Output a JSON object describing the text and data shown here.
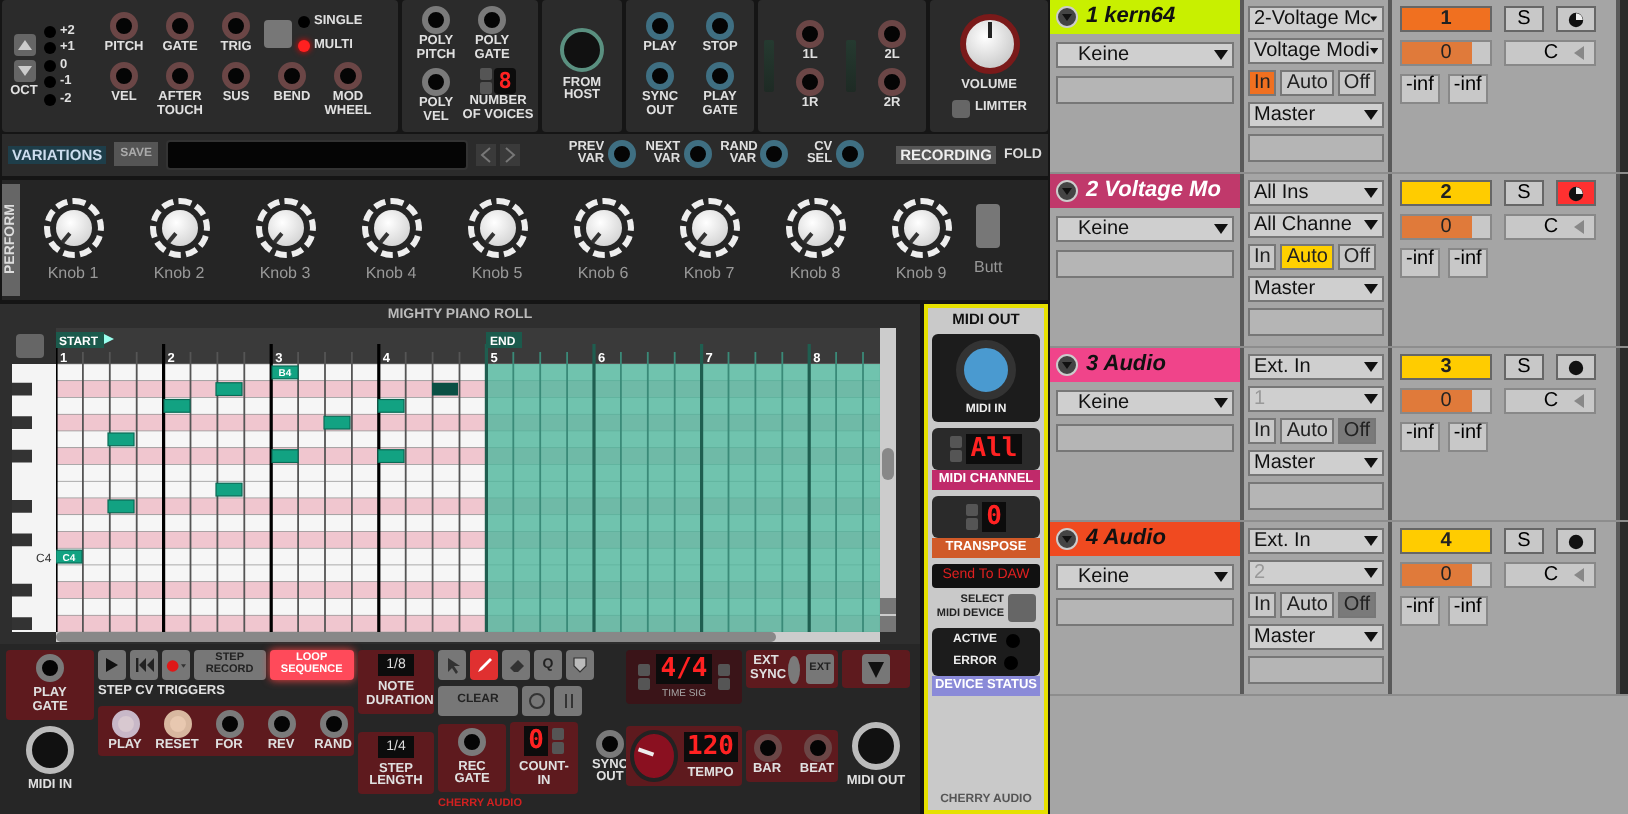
{
  "rack": {
    "octave": {
      "label": "OCT",
      "levels": [
        "+2",
        "+1",
        "0",
        "-1",
        "-2"
      ]
    },
    "mode_button": {
      "pressed": false
    },
    "trigger_mode": [
      {
        "label": "SINGLE",
        "selected": false
      },
      {
        "label": "MULTI",
        "selected": true
      }
    ],
    "jacks_top": [
      "PITCH",
      "GATE",
      "TRIG"
    ],
    "jacks_bottom": [
      "VEL",
      "AFTER TOUCH",
      "SUS",
      "BEND",
      "MOD WHEEL"
    ],
    "poly": {
      "jacks": [
        "POLY PITCH",
        "POLY GATE",
        "POLY VEL"
      ],
      "voices_label": "NUMBER OF VOICES",
      "voices": "8"
    },
    "host": {
      "label": "FROM HOST"
    },
    "transport_jacks": [
      "PLAY",
      "STOP",
      "SYNC OUT",
      "PLAY GATE"
    ],
    "outputs": [
      "1L",
      "2L",
      "1R",
      "2R"
    ],
    "volume": {
      "label": "VOLUME",
      "limiter": "LIMITER",
      "limiter_on": false
    }
  },
  "variations": {
    "title": "VARIATIONS",
    "save": "SAVE",
    "jacks": [
      "PREV VAR",
      "NEXT VAR",
      "RAND VAR",
      "CV SEL"
    ]
  },
  "recording": {
    "title": "RECORDING",
    "folder": "FOLD"
  },
  "perform": {
    "title": "PERFORM",
    "knobs": [
      "Knob 1",
      "Knob 2",
      "Knob 3",
      "Knob 4",
      "Knob 5",
      "Knob 6",
      "Knob 7",
      "Knob 8",
      "Knob 9"
    ],
    "extra": "Butt"
  },
  "piano_roll": {
    "title": "MIGHTY PIANO ROLL",
    "start": "START",
    "end": "END",
    "bars": [
      "1",
      "2",
      "3",
      "4",
      "5",
      "6",
      "7",
      "8"
    ],
    "key_label": "C4",
    "note_labels": [
      "B4",
      "C4"
    ]
  },
  "sequencer": {
    "play_gate": "PLAY GATE",
    "step_record": "STEP RECORD",
    "loop_sequence": {
      "label": "LOOP SEQUENCE",
      "on": true
    },
    "note_duration": {
      "value": "1/8",
      "label": "NOTE DURATION"
    },
    "tools": [
      {
        "kind": "pointer",
        "selected": false
      },
      {
        "kind": "pencil",
        "selected": true
      },
      {
        "kind": "eraser",
        "selected": false
      }
    ],
    "quantize": "Q",
    "clear": "CLEAR",
    "time_sig": {
      "value": "4/4",
      "label": "TIME SIG"
    },
    "ext_sync": "EXT SYNC",
    "ext": "EXT",
    "midi_in": "MIDI IN",
    "step_cv_title": "STEP CV TRIGGERS",
    "step_cv": [
      "PLAY",
      "RESET",
      "FOR",
      "REV",
      "RAND"
    ],
    "step_length": {
      "value": "1/4",
      "label": "STEP LENGTH"
    },
    "rec_gate": "REC GATE",
    "count_in": {
      "value": "0",
      "label": "COUNT-IN"
    },
    "sync_out": "SYNC OUT",
    "tempo": {
      "value": "120",
      "label": "TEMPO"
    },
    "bar": "BAR",
    "beat": "BEAT",
    "midi_out": "MIDI OUT",
    "brand": "CHERRY AUDIO"
  },
  "midi_out_module": {
    "title": "MIDI OUT",
    "input": "MIDI IN",
    "channel": {
      "value": "All",
      "label": "MIDI CHANNEL"
    },
    "transpose": {
      "value": "0",
      "label": "TRANSPOSE"
    },
    "send": "Send To DAW",
    "select": "SELECT MIDI DEVICE",
    "status": [
      {
        "label": "ACTIVE",
        "on": false
      },
      {
        "label": "ERROR",
        "on": false
      }
    ],
    "status_title": "DEVICE STATUS",
    "brand": "CHERRY AUDIO"
  },
  "tracks": [
    {
      "name": "1 kern64",
      "color": "#c8f000",
      "kind": "midi",
      "input_type": "Keine",
      "routing_from": "2-Voltage Mc",
      "routing_channel": "Voltage Modi",
      "channel_disabled": false,
      "monitor": [
        {
          "label": "In",
          "selected": true
        },
        {
          "label": "Auto",
          "selected": false
        },
        {
          "label": "Off",
          "selected": false
        }
      ],
      "output": "Master",
      "number": "1",
      "selected": true,
      "solo": "S",
      "armed": false,
      "volume": {
        "value": "0",
        "level": 0.8
      },
      "pan": "C",
      "meters": [
        "-inf",
        "-inf"
      ]
    },
    {
      "name": "2 Voltage Mo",
      "color": "#c0396b",
      "kind": "midi",
      "input_type": "Keine",
      "routing_from": "All Ins",
      "routing_channel": "All Channe",
      "channel_disabled": false,
      "monitor": [
        {
          "label": "In",
          "selected": false
        },
        {
          "label": "Auto",
          "selected": true
        },
        {
          "label": "Off",
          "selected": false
        }
      ],
      "output": "Master",
      "number": "2",
      "selected": false,
      "solo": "S",
      "armed": true,
      "volume": {
        "value": "0",
        "level": 0.8
      },
      "pan": "C",
      "meters": [
        "-inf",
        "-inf"
      ]
    },
    {
      "name": "3 Audio",
      "color": "#f0448a",
      "kind": "audio",
      "input_type": "Keine",
      "routing_from": "Ext. In",
      "routing_channel": "1",
      "channel_disabled": true,
      "monitor": [
        {
          "label": "In",
          "selected": false
        },
        {
          "label": "Auto",
          "selected": false
        },
        {
          "label": "Off",
          "selected": true
        }
      ],
      "output": "Master",
      "number": "3",
      "selected": false,
      "solo": "S",
      "armed": false,
      "volume": {
        "value": "0",
        "level": 0.8
      },
      "pan": "C",
      "meters": [
        "-inf",
        "-inf"
      ]
    },
    {
      "name": "4 Audio",
      "color": "#f04a20",
      "kind": "audio",
      "input_type": "Keine",
      "routing_from": "Ext. In",
      "routing_channel": "2",
      "channel_disabled": true,
      "monitor": [
        {
          "label": "In",
          "selected": false
        },
        {
          "label": "Auto",
          "selected": false
        },
        {
          "label": "Off",
          "selected": true
        }
      ],
      "output": "Master",
      "number": "4",
      "selected": false,
      "solo": "S",
      "armed": false,
      "volume": {
        "value": "0",
        "level": 0.8
      },
      "pan": "C",
      "meters": [
        "-inf",
        "-inf"
      ]
    }
  ]
}
